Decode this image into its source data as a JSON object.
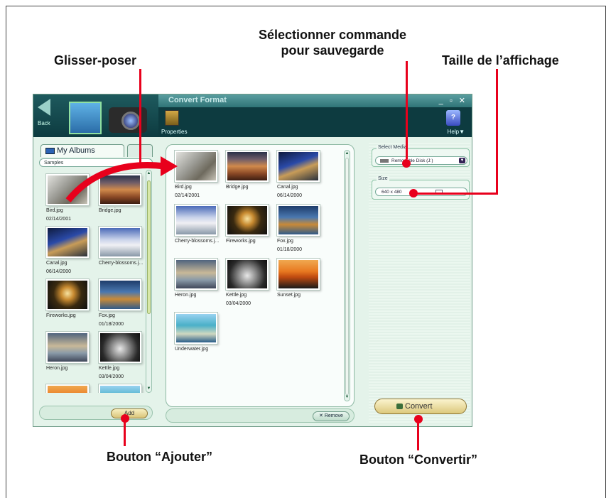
{
  "callouts": {
    "glisser": "Glisser-poser",
    "selectionner_line1": "Sélectionner commande",
    "selectionner_line2": "pour sauvegarde",
    "taille": "Taille de l’affichage",
    "ajouter": "Bouton “Ajouter”",
    "convertir": "Bouton “Convertir”"
  },
  "window": {
    "title": "Convert Format",
    "controls": "_ ▫ ✕",
    "back_label": "Back",
    "properties_label": "Properties",
    "help_label": "Help▼"
  },
  "left": {
    "tab_albums": "My Albums",
    "album_value": "Samples",
    "add_label": "Add",
    "items": [
      {
        "name": "Bird.jpg",
        "date": "02/14/2001",
        "img": "img-bird"
      },
      {
        "name": "Bridge.jpg",
        "date": "",
        "img": "img-bridge"
      },
      {
        "name": "Canal.jpg",
        "date": "06/14/2000",
        "img": "img-canal"
      },
      {
        "name": "Cherry-blossoms.j...",
        "date": "",
        "img": "img-cherry"
      },
      {
        "name": "Fireworks.jpg",
        "date": "",
        "img": "img-fireworks"
      },
      {
        "name": "Fox.jpg",
        "date": "01/18/2000",
        "img": "img-fox"
      },
      {
        "name": "Heron.jpg",
        "date": "",
        "img": "img-heron"
      },
      {
        "name": "Kettle.jpg",
        "date": "03/04/2000",
        "img": "img-kettle"
      },
      {
        "name": "",
        "date": "",
        "img": "img-sunset"
      },
      {
        "name": "",
        "date": "",
        "img": "img-underwater"
      }
    ]
  },
  "middle": {
    "remove_label": "Remove",
    "items": [
      {
        "name": "Bird.jpg",
        "date": "02/14/2001",
        "img": "img-bird"
      },
      {
        "name": "Bridge.jpg",
        "date": "",
        "img": "img-bridge"
      },
      {
        "name": "Canal.jpg",
        "date": "06/14/2000",
        "img": "img-canal"
      },
      {
        "name": "Cherry-blossoms.j...",
        "date": "",
        "img": "img-cherry"
      },
      {
        "name": "Fireworks.jpg",
        "date": "",
        "img": "img-fireworks"
      },
      {
        "name": "Fox.jpg",
        "date": "01/18/2000",
        "img": "img-fox"
      },
      {
        "name": "Heron.jpg",
        "date": "",
        "img": "img-heron"
      },
      {
        "name": "Kettle.jpg",
        "date": "03/04/2000",
        "img": "img-kettle"
      },
      {
        "name": "Sunset.jpg",
        "date": "",
        "img": "img-sunset"
      },
      {
        "name": "Underwater.jpg",
        "date": "",
        "img": "img-underwater"
      }
    ]
  },
  "right": {
    "media_group": "Select Media",
    "media_value": "Removable Disk (J:)",
    "size_group": "Size",
    "size_value": "640 x 480",
    "convert_label": "Convert"
  },
  "colors": {
    "callout_red": "#e8001c",
    "header_dark": "#0d3b40",
    "panel_green": "#e4f3ea"
  }
}
